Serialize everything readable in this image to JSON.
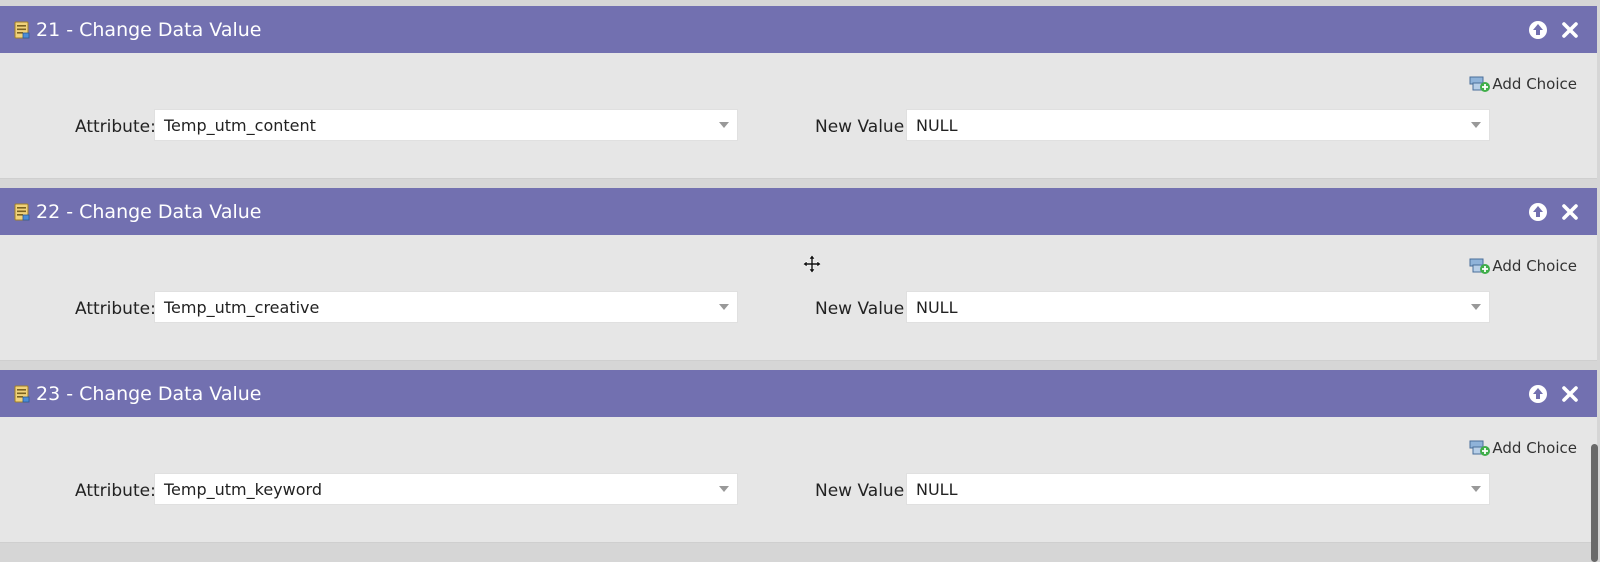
{
  "steps": [
    {
      "title": "21 - Change Data Value",
      "add_choice_label": "Add Choice",
      "attribute_label": "Attribute:",
      "attribute_value": "Temp_utm_content",
      "new_value_label": "New Value:",
      "new_value": "NULL"
    },
    {
      "title": "22 - Change Data Value",
      "add_choice_label": "Add Choice",
      "attribute_label": "Attribute:",
      "attribute_value": "Temp_utm_creative",
      "new_value_label": "New Value:",
      "new_value": "NULL"
    },
    {
      "title": "23 - Change Data Value",
      "add_choice_label": "Add Choice",
      "attribute_label": "Attribute:",
      "attribute_value": "Temp_utm_keyword",
      "new_value_label": "New Value:",
      "new_value": "NULL"
    }
  ],
  "icons": {
    "step": "flow-step-icon",
    "move_up": "move-up-icon",
    "close": "close-icon",
    "add_choice": "add-choice-icon",
    "dropdown": "chevron-down-icon",
    "cursor": "move-cursor-icon"
  },
  "colors": {
    "header_bg": "#7270b0",
    "body_bg": "#e6e6e6",
    "page_bg": "#d6d6d6"
  }
}
